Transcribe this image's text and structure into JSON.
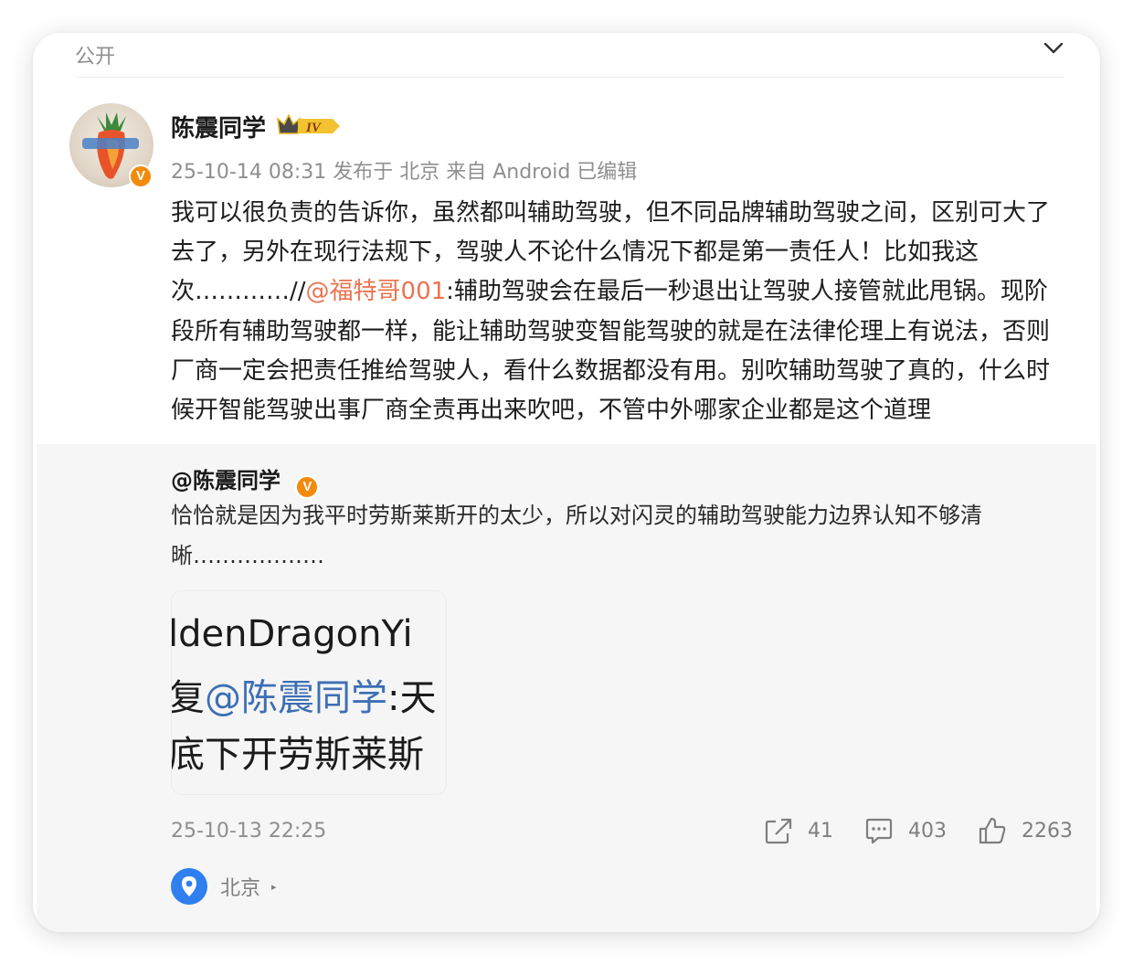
{
  "visibility": {
    "label": "公开"
  },
  "post": {
    "author": "陈震同学",
    "rank_label": "IV",
    "meta": "25-10-14 08:31 发布于 北京 来自 Android 已编辑",
    "text_before_link": "我可以很负责的告诉你，虽然都叫辅助驾驶，但不同品牌辅助驾驶之间，区别可大了去了，另外在现行法规下，驾驶人不论什么情况下都是第一责任人！比如我这次…………//",
    "mention": "@福特哥001",
    "text_after_link": ":辅助驾驶会在最后一秒退出让驾驶人接管就此甩锅。现阶段所有辅助驾驶都一样，能让辅助驾驶变智能驾驶的就是在法律伦理上有说法，否则厂商一定会把责任推给驾驶人，看什么数据都没有用。别吹辅助驾驶了真的，什么时候开智能驾驶出事厂商全责再出来吹吧，不管中外哪家企业都是这个道理"
  },
  "retweet": {
    "author": "@陈震同学",
    "text": "恰恰就是因为我平时劳斯莱斯开的太少，所以对闪灵的辅助驾驶能力边界认知不够清晰………………",
    "image_lines": [
      "ldenDragonYi",
      "复@陈震同学:天",
      "底下开劳斯莱斯"
    ],
    "image_mention": "@陈震同学",
    "time": "25-10-13 22:25",
    "stats": {
      "reposts": "41",
      "comments": "403",
      "likes": "2263"
    },
    "location": "北京"
  },
  "colors": {
    "link": "#eb7350",
    "verified": "#f28a0c",
    "location_pin": "#2f7ff0",
    "muted": "#8f8f8f"
  }
}
